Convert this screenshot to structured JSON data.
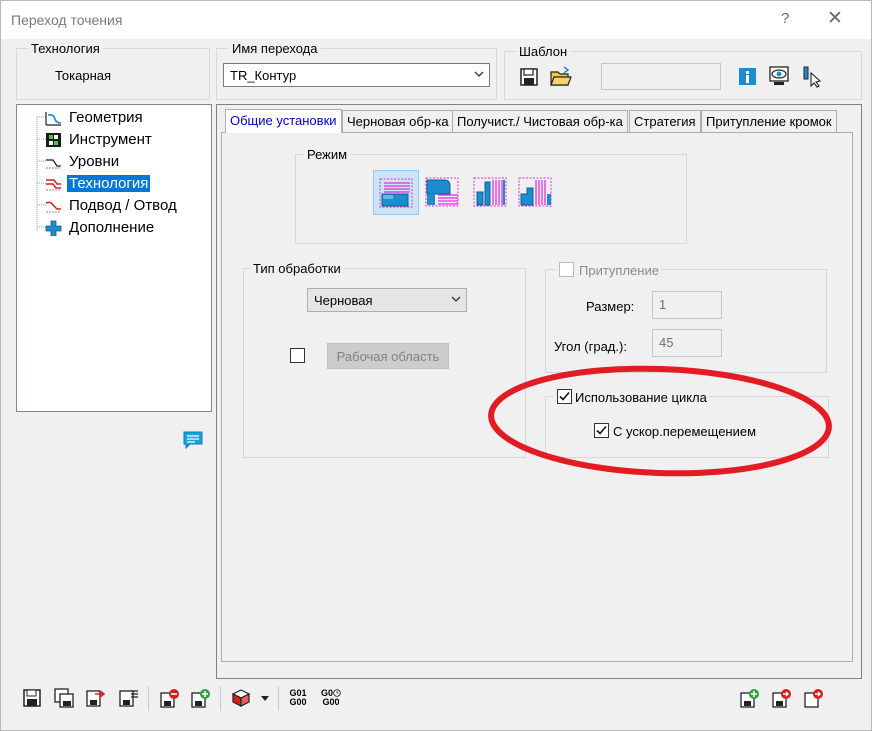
{
  "window": {
    "title": "Переход точения",
    "help": "?",
    "close": "✕"
  },
  "technology": {
    "label": "Технология",
    "value": "Токарная"
  },
  "operation": {
    "label": "Имя перехода",
    "value": "TR_Контур"
  },
  "template": {
    "label": "Шаблон",
    "field_value": ""
  },
  "tree": {
    "items": [
      {
        "label": "Геометрия",
        "icon": "geometry-icon"
      },
      {
        "label": "Инструмент",
        "icon": "tool-icon"
      },
      {
        "label": "Уровни",
        "icon": "levels-icon"
      },
      {
        "label": "Технология",
        "icon": "technology-icon",
        "selected": true
      },
      {
        "label": "Подвод / Отвод",
        "icon": "approach-retract-icon"
      },
      {
        "label": "Дополнение",
        "icon": "additional-icon"
      }
    ]
  },
  "tabs": [
    {
      "label": "Общие установки",
      "active": true
    },
    {
      "label": "Черновая обр-ка"
    },
    {
      "label": "Получист./ Чистовая обр-ка"
    },
    {
      "label": "Стратегия"
    },
    {
      "label": "Притупление кромок"
    }
  ],
  "mode": {
    "label": "Режим",
    "selected_index": 0
  },
  "machining_type": {
    "label": "Тип обработки",
    "value": "Черновая",
    "work_area_label": "Рабочая область",
    "work_area_checked": false
  },
  "chamfer": {
    "label": "Притупление",
    "checked": false,
    "size_label": "Размер:",
    "size_value": "1",
    "angle_label": "Угол (град.):",
    "angle_value": "45"
  },
  "cycle": {
    "label": "Использование цикла",
    "checked": true,
    "rapid_label": "С ускор.перемещением",
    "rapid_checked": true
  },
  "bottom_toolbar": {
    "g01_line1": "G01",
    "g01_line2": "G00",
    "g0c_line1": "G0",
    "g0c_line2": "G00"
  },
  "colors": {
    "selection": "#0078d7",
    "annotation": "#e31b23",
    "accent_pink": "#e02ee0",
    "icon_blue": "#1a8ccf"
  }
}
